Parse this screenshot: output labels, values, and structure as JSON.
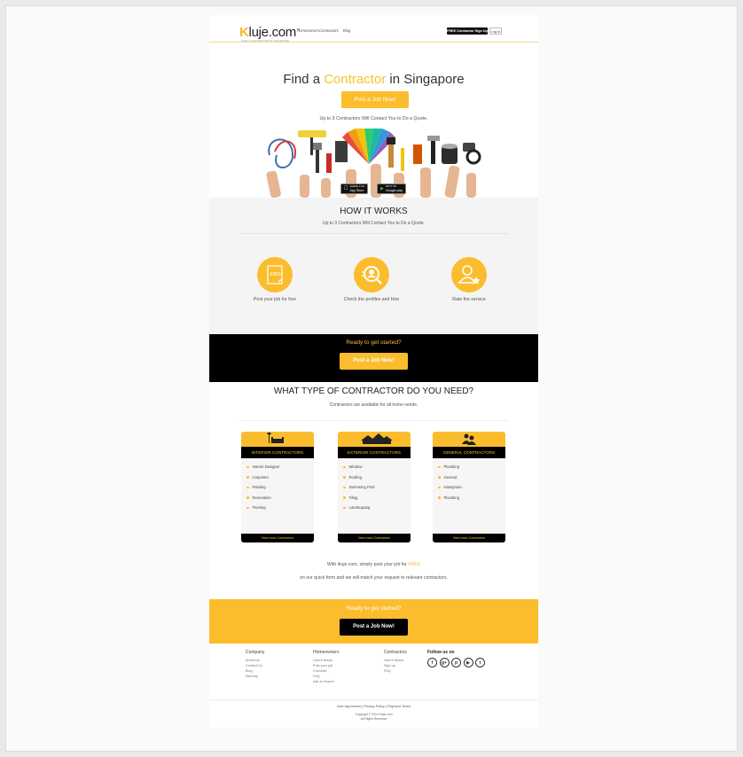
{
  "header": {
    "logo_prefix": "K",
    "logo_rest": "luje.com",
    "logo_mark": "™",
    "logo_tagline": "FIND A CONTRACTOR IN SINGAPORE",
    "nav": [
      "Homeowners",
      "Contractors",
      "Blog"
    ],
    "free_signup_label": "FREE Contractor Sign Up",
    "login_label": "Log In"
  },
  "hero": {
    "title_before": "Find a ",
    "title_accent": "Contractor",
    "title_after": " in Singapore",
    "cta_label": "Post a Job Now!",
    "subtitle": "Up to 3 Contractors Will Contact You to Do a Quote.",
    "app_store": {
      "small": "Available on the",
      "big": "App Store"
    },
    "google_play": {
      "small": "GET IT ON",
      "big": "Google play"
    }
  },
  "how_it_works": {
    "title": "HOW IT WORKS",
    "subtitle": "Up to 3 Contractors Will Contact You to Do a Quote.",
    "steps": [
      {
        "label": "Post your job for free",
        "icon": "jobs-board-icon",
        "icon_text": "JOBS"
      },
      {
        "label": "Check the profiles and Hire",
        "icon": "search-profile-icon"
      },
      {
        "label": "Rate the service",
        "icon": "user-star-icon"
      }
    ]
  },
  "cta_black": {
    "text": "Ready to get started?",
    "button": "Post a Job Now!"
  },
  "contractor_types": {
    "title": "WHAT TYPE OF CONTRACTOR DO YOU NEED?",
    "subtitle": "Contractors are available for all home needs.",
    "cards": [
      {
        "title": "INTERIOR CONTRACTORS",
        "icon": "sofa-lamp-icon",
        "items": [
          "Interior Designer",
          "Carpenter",
          "Painting",
          "Renovation",
          "Flooring"
        ],
        "footer": "View more Contractors"
      },
      {
        "title": "EXTERIOR CONTRACTORS",
        "icon": "houses-icon",
        "items": [
          "Window",
          "Roofing",
          "Swimming Pool",
          "Tiling",
          "Landscaping"
        ],
        "footer": "View more Contractors"
      },
      {
        "title": "GENERAL CONTRACTORS",
        "icon": "workers-icon",
        "items": [
          "Plumbing",
          "General",
          "Handyman",
          "Plumbing"
        ],
        "footer": "View more Contractors"
      }
    ]
  },
  "blurb": {
    "line1_before": "With kluje.com, simply post your job for ",
    "line1_accent": "FREE",
    "line2": "on our quick form and we will match your request to relevant contractors."
  },
  "cta_yellow": {
    "text": "Ready to get started?",
    "button": "Post a Job Now!"
  },
  "footer": {
    "company": {
      "title": "Company",
      "links": [
        "About Us",
        "Contact Us",
        "Blog",
        "Sitemap"
      ]
    },
    "homeowners": {
      "title": "Homeowners",
      "links": [
        "How it Works",
        "Post your job",
        "Checklist",
        "FAQ",
        "Ask an Expert"
      ]
    },
    "contractors": {
      "title": "Contractors",
      "links": [
        "How it Works",
        "Sign up",
        "FAQ"
      ]
    },
    "follow": {
      "title": "Follow us on",
      "icons": [
        "facebook-icon",
        "google-plus-icon",
        "pinterest-icon",
        "youtube-icon",
        "twitter-icon"
      ]
    },
    "legal": "User Agreement | Privacy Policy | Payment Terms",
    "copyright": "Copyright © 2014 Kluje.com",
    "rights": "All Rights Reserved"
  }
}
